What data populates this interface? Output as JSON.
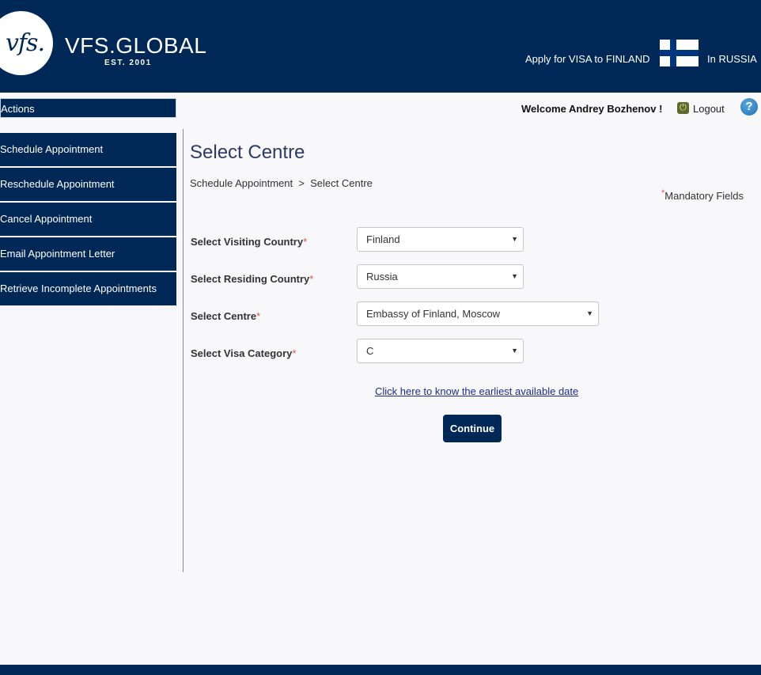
{
  "header": {
    "logo_text": "vfs.",
    "brand": "VFS.GLOBAL",
    "est": "EST. 2001",
    "apply_text": "Apply for VISA to FINLAND",
    "in_text": "In RUSSIA",
    "flag_icon": "finland-flag-icon"
  },
  "sidebar": {
    "actions_label": "Actions",
    "items": [
      {
        "label": "Schedule Appointment"
      },
      {
        "label": "Reschedule Appointment"
      },
      {
        "label": "Cancel Appointment"
      },
      {
        "label": "Email Appointment Letter"
      },
      {
        "label": "Retrieve Incomplete Appointments"
      }
    ]
  },
  "userbar": {
    "welcome": "Welcome Andrey Bozhenov !",
    "logout": "Logout",
    "help": "?"
  },
  "main": {
    "title": "Select Centre",
    "breadcrumb": "Schedule Appointment  >  Select Centre",
    "mandatory": "Mandatory Fields",
    "required_mark": "*",
    "fields": [
      {
        "label": "Select Visiting Country",
        "value": "Finland"
      },
      {
        "label": "Select Residing Country",
        "value": "Russia"
      },
      {
        "label": "Select Centre",
        "value": "Embassy of Finland, Moscow"
      },
      {
        "label": "Select Visa Category",
        "value": "C"
      }
    ],
    "earliest_link": "Click here to know the earliest available date",
    "continue": "Continue"
  },
  "colors": {
    "brand_navy": "#002856",
    "title_blue": "#2b3a6b",
    "required_red": "#d9534f",
    "link_blue": "#1a2d8f"
  }
}
